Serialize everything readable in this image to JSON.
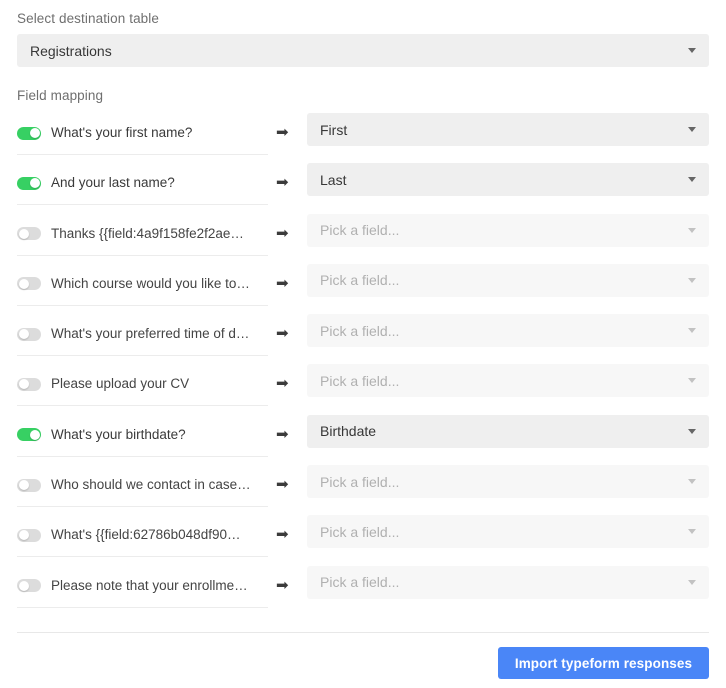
{
  "destination": {
    "label": "Select destination table",
    "selected": "Registrations",
    "caret_icon": "chevron-down-icon"
  },
  "field_mapping": {
    "label": "Field mapping",
    "arrow_icon": "arrow-right-icon",
    "placeholder": "Pick a field...",
    "rows": [
      {
        "enabled": true,
        "question": "What's your first name?",
        "destination": "First"
      },
      {
        "enabled": true,
        "question": "And your last name?",
        "destination": "Last"
      },
      {
        "enabled": false,
        "question": "Thanks {{field:4a9f158fe2f2ae…",
        "destination": "Pick a field..."
      },
      {
        "enabled": false,
        "question": "Which course would you like to…",
        "destination": "Pick a field..."
      },
      {
        "enabled": false,
        "question": "What's your preferred time of d…",
        "destination": "Pick a field..."
      },
      {
        "enabled": false,
        "question": "Please upload your CV",
        "destination": "Pick a field..."
      },
      {
        "enabled": true,
        "question": "What's your birthdate?",
        "destination": "Birthdate"
      },
      {
        "enabled": false,
        "question": "Who should we contact in case…",
        "destination": "Pick a field..."
      },
      {
        "enabled": false,
        "question": "What's {{field:62786b048df90…",
        "destination": "Pick a field..."
      },
      {
        "enabled": false,
        "question": "Please note that your enrollme…",
        "destination": "Pick a field..."
      }
    ]
  },
  "footer": {
    "submit_label": "Import typeform responses"
  },
  "colors": {
    "toggle_on": "#37d063",
    "toggle_off": "#dcdcdc",
    "primary_button": "#4a86f7",
    "select_filled_bg": "#efefef",
    "select_empty_bg": "#f7f7f7"
  }
}
